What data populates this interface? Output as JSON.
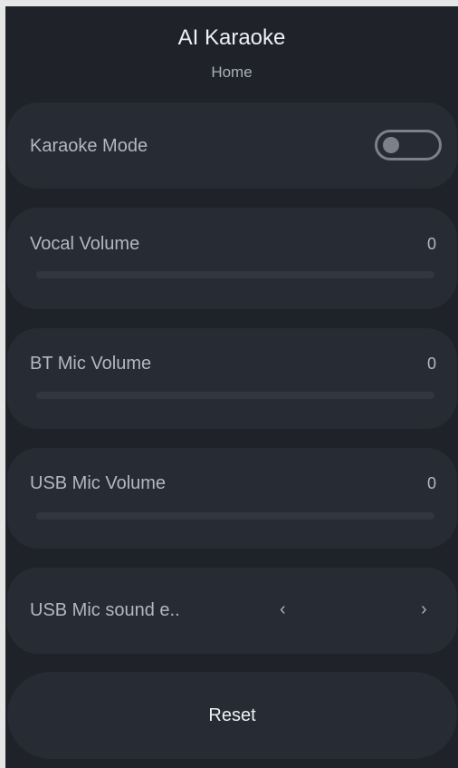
{
  "header": {
    "title": "AI Karaoke",
    "subtitle": "Home"
  },
  "settings": {
    "karaoke_mode": {
      "label": "Karaoke Mode",
      "enabled": false
    },
    "vocal_volume": {
      "label": "Vocal Volume",
      "value": "0",
      "fraction": 0
    },
    "bt_mic_volume": {
      "label": "BT Mic Volume",
      "value": "0",
      "fraction": 0
    },
    "usb_mic_volume": {
      "label": "USB Mic Volume",
      "value": "0",
      "fraction": 0
    },
    "usb_mic_sound_effect": {
      "label": "USB Mic sound e..",
      "prev_icon": "‹",
      "next_icon": "›"
    }
  },
  "footer": {
    "reset_label": "Reset"
  },
  "colors": {
    "background": "#1f2229",
    "card": "#272b33",
    "text_primary": "#eef0f3",
    "text_secondary": "#b3b8c0"
  }
}
